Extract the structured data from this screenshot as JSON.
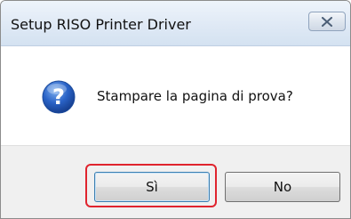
{
  "window": {
    "title": "Setup RISO Printer Driver"
  },
  "dialog": {
    "icon": "question-icon",
    "message": "Stampare la pagina di prova?"
  },
  "buttons": {
    "yes_label": "Sì",
    "no_label": "No"
  },
  "colors": {
    "highlight": "#e0242e",
    "icon_blue": "#2a63c7",
    "default_button_border": "#3c7fb1"
  }
}
